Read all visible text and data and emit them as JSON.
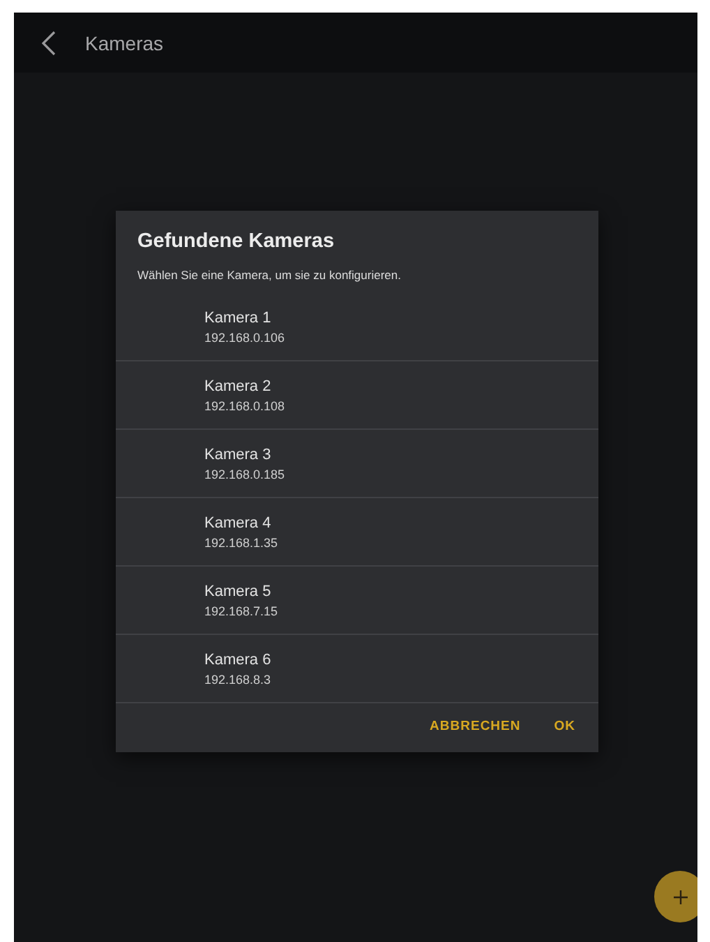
{
  "app_bar": {
    "title": "Kameras"
  },
  "dialog": {
    "title": "Gefundene Kameras",
    "message": "Wählen Sie eine Kamera, um sie zu konfigurieren.",
    "items": [
      {
        "name": "Kamera 1",
        "address": "192.168.0.106"
      },
      {
        "name": "Kamera 2",
        "address": "192.168.0.108"
      },
      {
        "name": "Kamera 3",
        "address": "192.168.0.185"
      },
      {
        "name": "Kamera 4",
        "address": "192.168.1.35"
      },
      {
        "name": "Kamera 5",
        "address": "192.168.7.15"
      },
      {
        "name": "Kamera 6",
        "address": "192.168.8.3"
      }
    ],
    "buttons": [
      "ABBRECHEN",
      "OK"
    ]
  }
}
